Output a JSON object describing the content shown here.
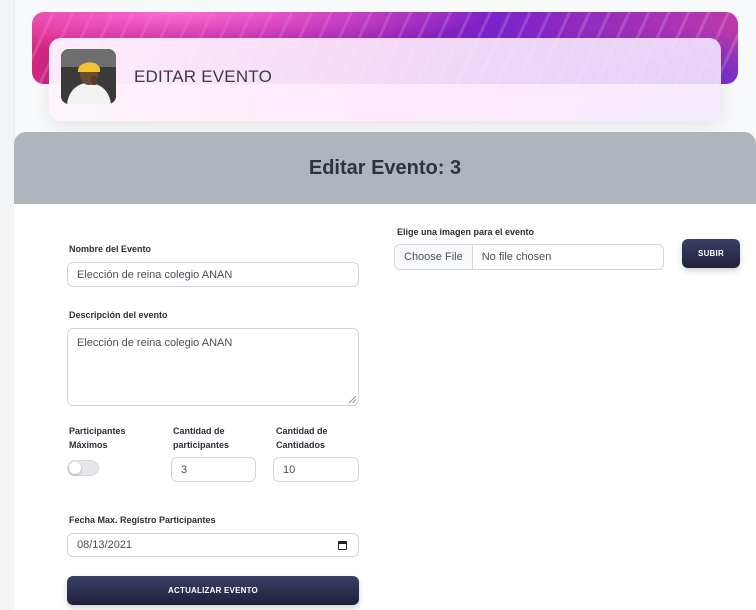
{
  "header": {
    "title": "EDITAR EVENTO"
  },
  "panel": {
    "title": "Editar Evento: 3"
  },
  "form": {
    "name_label": "Nombre del Evento",
    "name_value": "Elección de reina colegio ANAN",
    "description_label": "Descripción del evento",
    "description_value": "Elección de reina colegio ANAN",
    "max_participants_label_1": "Participantes",
    "max_participants_label_2": "Máximos",
    "max_participants_enabled": false,
    "participants_qty_label_1": "Cantidad de",
    "participants_qty_label_2": "participantes",
    "participants_qty_value": "3",
    "candidates_qty_label_1": "Cantidad de",
    "candidates_qty_label_2": "Cantidados",
    "candidates_qty_value": "10",
    "date_label": "Fecha Max. Registro Participantes",
    "date_value": "08/13/2021",
    "submit_label": "ACTUALIZAR EVENTO"
  },
  "image_upload": {
    "label": "Elige una imagen para el evento",
    "choose_button": "Choose File",
    "no_file_text": "No file chosen",
    "upload_button": "SUBIR"
  },
  "icons": {
    "avatar": "user-avatar",
    "calendar": "calendar-icon"
  }
}
